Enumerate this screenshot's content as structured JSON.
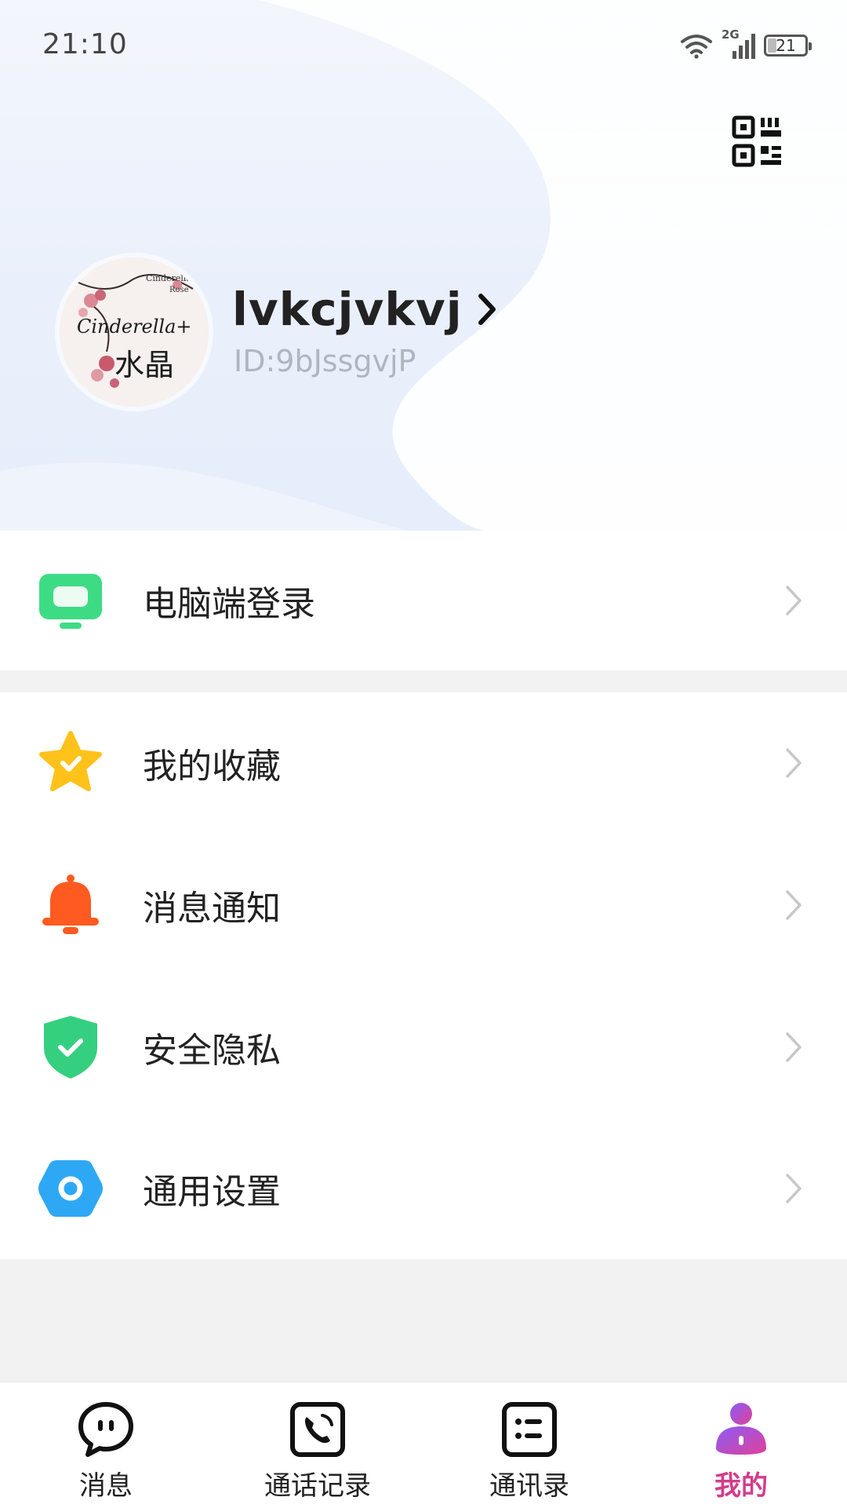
{
  "status_bar": {
    "time": "21:10",
    "network": "2G",
    "battery": "21",
    "battery_level": 0.21
  },
  "profile": {
    "name": "lvkcjvkvj",
    "id": "ID:9bJssgvjP",
    "avatar_text": {
      "line1": "Cinderella",
      "line2": "Rose",
      "script": "Cinderella+",
      "cjk": "水晶"
    }
  },
  "menu": {
    "pc_login": {
      "label": "电脑端登录",
      "icon": "monitor-icon",
      "color": "#3ddc84"
    },
    "items": [
      {
        "label": "我的收藏",
        "icon": "star-icon",
        "color": "#ffc21a"
      },
      {
        "label": "消息通知",
        "icon": "bell-icon",
        "color": "#ff5a1f"
      },
      {
        "label": "安全隐私",
        "icon": "shield-icon",
        "color": "#35d07f"
      },
      {
        "label": "通用设置",
        "icon": "settings-icon",
        "color": "#2ea8f5"
      }
    ]
  },
  "tabs": [
    {
      "label": "消息",
      "icon": "chat-icon",
      "active": false
    },
    {
      "label": "通话记录",
      "icon": "phone-icon",
      "active": false
    },
    {
      "label": "通讯录",
      "icon": "contacts-icon",
      "active": false
    },
    {
      "label": "我的",
      "icon": "person-icon",
      "active": true
    }
  ],
  "colors": {
    "accent": "#d23d8c",
    "text": "#222222",
    "muted": "#b0b6c0",
    "background": "#f2f2f2"
  }
}
